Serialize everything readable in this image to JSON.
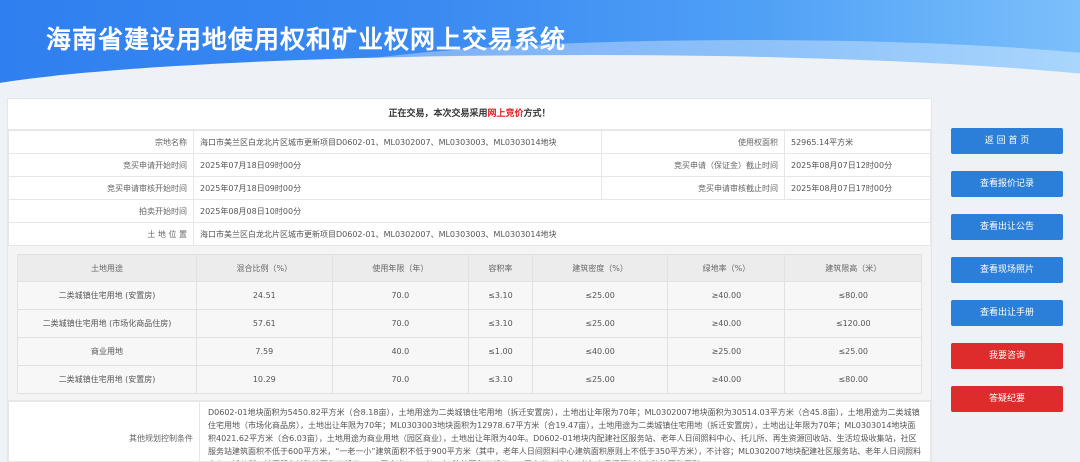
{
  "header": {
    "title": "海南省建设用地使用权和矿业权网上交易系统"
  },
  "notice": {
    "prefix": "正在交易，本次交易采用",
    "highlight": "网上竞价",
    "suffix": "方式！"
  },
  "info": {
    "parcel_label": "宗地名称",
    "parcel_value": "海口市美兰区白龙北片区城市更新项目D0602-01、ML0302007、ML0303003、ML0303014地块",
    "area_label": "使用权面积",
    "area_value": "52965.14平方米",
    "apply_start_label": "竞买申请开始时间",
    "apply_start_value": "2025年07月18日09时00分",
    "apply_end_label": "竞买申请（保证金）截止时间",
    "apply_end_value": "2025年08月07日12时00分",
    "review_start_label": "竞买申请审核开始时间",
    "review_start_value": "2025年07月18日09时00分",
    "review_end_label": "竞买申请审核截止时间",
    "review_end_value": "2025年08月07日17时00分",
    "auction_start_label": "拍卖开始时间",
    "auction_start_value": "2025年08月08日10时00分",
    "location_label": "土 地 位 置",
    "location_value": "海口市美兰区白龙北片区城市更新项目D0602-01、ML0302007、ML0303003、ML0303014地块"
  },
  "land_table": {
    "headers": [
      "土地用途",
      "混合比例（%）",
      "使用年限（年）",
      "容积率",
      "建筑密度（%）",
      "绿地率（%）",
      "建筑限高（米）"
    ],
    "rows": [
      [
        "二类城镇住宅用地 (安置房)",
        "24.51",
        "70.0",
        "≤3.10",
        "≤25.00",
        "≥40.00",
        "≤80.00"
      ],
      [
        "二类城镇住宅用地 (市场化商品住房)",
        "57.61",
        "70.0",
        "≤3.10",
        "≤25.00",
        "≥40.00",
        "≤120.00"
      ],
      [
        "商业用地",
        "7.59",
        "40.0",
        "≤1.00",
        "≤40.00",
        "≥25.00",
        "≤25.00"
      ],
      [
        "二类城镇住宅用地 (安置房)",
        "10.29",
        "70.0",
        "≤3.10",
        "≤25.00",
        "≥40.00",
        "≤80.00"
      ]
    ]
  },
  "conditions": {
    "label": "其他规划控制条件",
    "text": "D0602-01地块面积为5450.82平方米（合8.18亩），土地用途为二类城镇住宅用地（拆迁安置房），土地出让年限为70年；ML0302007地块面积为30514.03平方米（合45.8亩），土地用途为二类城镇住宅用地（市场化商品房），土地出让年限为70年；ML0303003地块面积为12978.67平方米（合19.47亩），土地用途为二类城镇住宅用地（拆迁安置房），土地出让年限为70年；ML0303014地块面积4021.62平方米（合6.03亩），土地用途为商业用地（园区商业），土地出让年限为40年。D0602-01地块内配建社区服务站、老年人日间照料中心、托儿所、再生资源回收站、生活垃圾收集站，社区服务站建筑面积不低于600平方米，“一老一小”建筑面积不低于900平方米（其中，老年人日间照料中心建筑面积原则上不低于350平方米），不计容；ML0302007地块配建社区服务站、老年人日间照料中心、托儿所，社区服务站建筑面积不低于2000平方米，“一老一小”建筑面积不低于900平方米（其中，老年人日间照料中心建筑面积原则"
  },
  "buttons": [
    {
      "label": "返 回 首 页",
      "color": "#2c7fd8"
    },
    {
      "label": "查看报价记录",
      "color": "#2c7fd8"
    },
    {
      "label": "查看出让公告",
      "color": "#2c7fd8"
    },
    {
      "label": "查看现场照片",
      "color": "#2c7fd8"
    },
    {
      "label": "查看出让手册",
      "color": "#2c7fd8"
    },
    {
      "label": "我要咨询",
      "color": "#de2b2b"
    },
    {
      "label": "答疑纪要",
      "color": "#de2b2b"
    }
  ]
}
